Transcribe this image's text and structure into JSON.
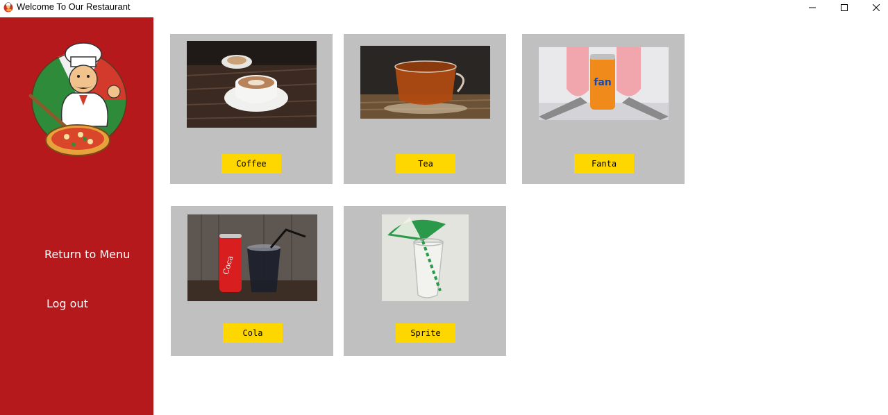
{
  "window": {
    "title": "Welcome To Our Restaurant",
    "controls": [
      "minimize",
      "maximize",
      "close"
    ]
  },
  "sidebar": {
    "logo": "chef-with-pizza-logo",
    "links": [
      {
        "label": "Return to Menu"
      },
      {
        "label": "Log out"
      }
    ]
  },
  "drinks": [
    {
      "label": "Coffee",
      "image": "coffee-cup-photo"
    },
    {
      "label": "Tea",
      "image": "tea-cup-photo"
    },
    {
      "label": "Fanta",
      "image": "fanta-can-photo"
    },
    {
      "label": "Cola",
      "image": "cola-can-photo"
    },
    {
      "label": "Sprite",
      "image": "sprite-glass-photo"
    }
  ],
  "colors": {
    "sidebar": "#b5191c",
    "card": "#c0c0c0",
    "button": "#ffd700"
  }
}
